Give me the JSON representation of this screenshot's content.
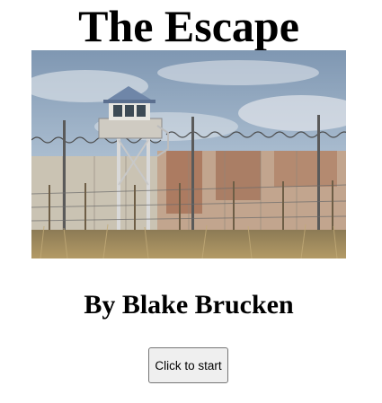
{
  "page": {
    "title": "The Escape",
    "byline": "By Blake Brucken",
    "start_button_label": "Click to start"
  },
  "hero_image": {
    "subject": "prison-wall-with-watchtower",
    "colors": {
      "sky": "#8fa6bd",
      "wall": "#c9c3b5",
      "rust": "#9a5a3c",
      "grass": "#a78c5a",
      "tower_roof": "#6f86a8"
    }
  }
}
